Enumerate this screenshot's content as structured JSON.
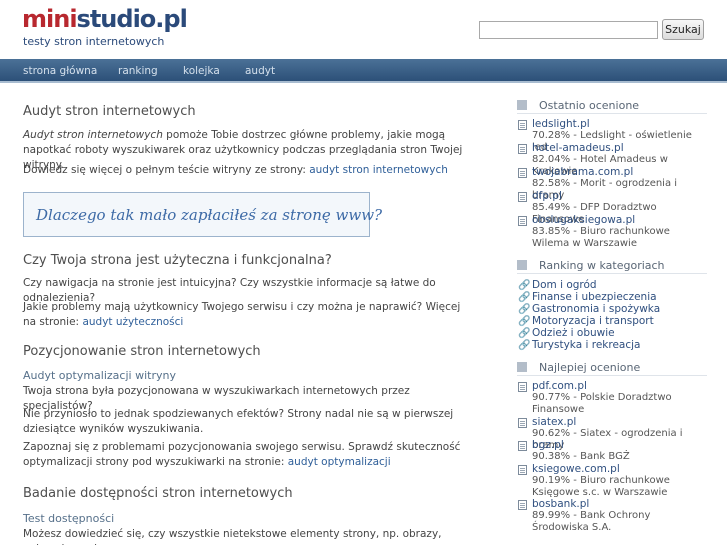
{
  "header": {
    "logo_mini": "mini",
    "logo_studio": "studio.pl",
    "logo_sub": "testy stron internetowych"
  },
  "search": {
    "value": "",
    "placeholder": "",
    "button_label": "Szukaj"
  },
  "nav": {
    "items": [
      "strona główna",
      "ranking",
      "kolejka",
      "audyt"
    ]
  },
  "main": {
    "title": "Audyt stron internetowych",
    "intro_em": "Audyt stron internetowych",
    "intro_rest": " pomoże Tobie dostrzec główne problemy, jakie mogą napotkać roboty wyszukiwarek oraz użytkownicy podczas przeglądania stron Twojej witryny.",
    "more_text": "Dowiedz się więcej o pełnym teście witryny ze strony: ",
    "more_link": "audyt stron internetowych",
    "banner_text": "Dlaczego tak mało zapłaciłeś za stronę www?",
    "section1_title": "Czy Twoja strona jest użyteczna i funkcjonalna?",
    "section1_p1": "Czy nawigacja na stronie jest intuicyjna? Czy wszystkie informacje są łatwe do odnalezienia?",
    "section1_p2": "Jakie problemy mają użytkownicy Twojego serwisu i czy można je naprawić? Więcej na stronie: ",
    "section1_link": "audyt użyteczności",
    "section2_title": "Pozycjonowanie stron internetowych",
    "section2_sub": "Audyt optymalizacji witryny",
    "section2_p1": "Twoja strona była pozycjonowana w wyszukiwarkach internetowych przez specjalistów?",
    "section2_p2": "Nie przyniosło to jednak spodziewanych efektów? Strony nadal nie są w pierwszej dziesiątce wyników wyszukiwania.",
    "section2_p3": "Zapoznaj się z problemami pozycjonowania swojego serwisu. Sprawdź skuteczność optymalizacji strony pod wyszukiwarki na stronie: ",
    "section2_link": "audyt optymalizacji",
    "section3_title": "Badanie dostępności stron internetowych",
    "section3_sub": "Test dostępności",
    "section3_p1": "Możesz dowiedzieć się, czy wszystkie nietekstowe elementy strony, np. obrazy, animacje, mają"
  },
  "sidebar": {
    "recent": {
      "title": "Ostatnio ocenione",
      "items": [
        {
          "site": "ledslight.pl",
          "desc": "70.28% - Ledslight - oświetlenie led"
        },
        {
          "site": "hotel-amadeus.pl",
          "desc": "82.04% - Hotel Amadeus w Krakowie"
        },
        {
          "site": "twojabrama.com.pl",
          "desc": "82.58% - Morit - ogrodzenia i bramy"
        },
        {
          "site": "dfp.pl",
          "desc": "85.49% - DFP Doradztwo Finansowe"
        },
        {
          "site": "obslugaksiegowa.pl",
          "desc": "83.85% - Biuro rachunkowe Wilema w Warszawie"
        }
      ]
    },
    "categories": {
      "title": "Ranking w kategoriach",
      "items": [
        "Dom i ogród",
        "Finanse i ubezpieczenia",
        "Gastronomia i spożywka",
        "Motoryzacja i transport",
        "Odzież i obuwie",
        "Turystyka i rekreacja"
      ]
    },
    "best": {
      "title": "Najlepiej ocenione",
      "items": [
        {
          "site": "pdf.com.pl",
          "desc": "90.77% - Polskie Doradztwo Finansowe"
        },
        {
          "site": "siatex.pl",
          "desc": "90.62% - Siatex - ogrodzenia i bramy"
        },
        {
          "site": "bgz.pl",
          "desc": "90.38% - Bank BGŻ"
        },
        {
          "site": "ksiegowe.com.pl",
          "desc": "90.19% - Biuro rachunkowe Księgowe s.c. w Warszawie"
        },
        {
          "site": "bosbank.pl",
          "desc": "89.99% - Bank Ochrony Środowiska S.A."
        }
      ]
    }
  },
  "colors": {
    "nav_bg": "#3a6089",
    "logo_red": "#b8282f",
    "logo_blue": "#2b4a7a",
    "link": "#2f5f99"
  }
}
